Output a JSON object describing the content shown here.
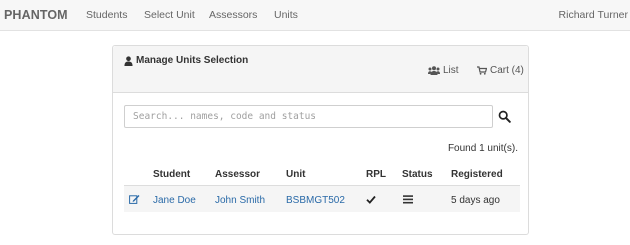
{
  "navbar": {
    "brand": "PHANTOM",
    "links": [
      "Students",
      "Select Unit",
      "Assessors",
      "Units"
    ],
    "user": "Richard Turner"
  },
  "panel": {
    "title": "Manage Units Selection",
    "list_label": "List",
    "cart_label": "Cart (4)"
  },
  "search": {
    "placeholder": "Search... names, code and status"
  },
  "results": {
    "found_text": "Found 1 unit(s)."
  },
  "table": {
    "headers": [
      "Student",
      "Assessor",
      "Unit",
      "RPL",
      "Status",
      "Registered"
    ],
    "rows": [
      {
        "student": "Jane Doe",
        "assessor": "John Smith",
        "unit": "BSBMGT502",
        "rpl": true,
        "status_icon": "list-icon",
        "registered": "5 days ago"
      }
    ]
  },
  "colors": {
    "link": "#2a6aa8",
    "navbar_bg": "#f7f7f7",
    "panel_heading_bg": "#f5f5f5",
    "row_bg": "#f5f5f5"
  }
}
